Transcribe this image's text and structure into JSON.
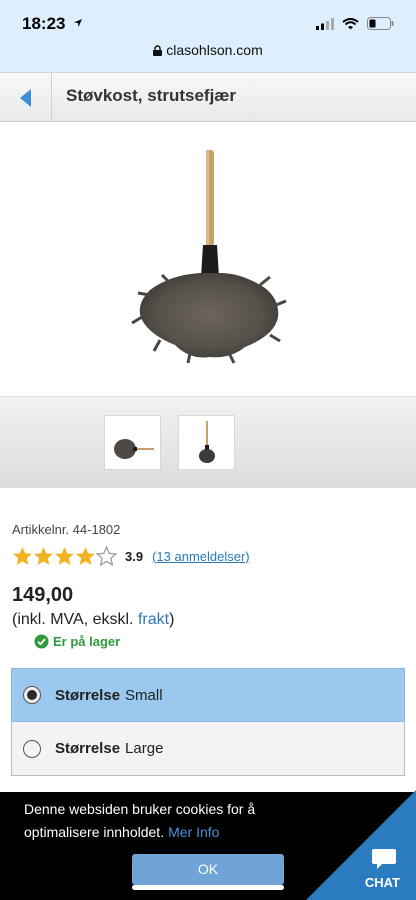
{
  "status_bar": {
    "time": "18:23",
    "url": "clasohlson.com"
  },
  "header": {
    "title": "Støvkost, strutsefjær"
  },
  "product": {
    "article_number": "Artikkelnr. 44-1802",
    "rating": 3.9,
    "rating_text": "3.9",
    "stars_filled": 4,
    "stars_total": 5,
    "reviews_link": "(13 anmeldelser)",
    "price": "149,00",
    "vat_prefix": "(inkl. MVA,  ekskl.",
    "vat_link": "frakt",
    "vat_suffix": ")",
    "stock": "Er på lager"
  },
  "options": [
    {
      "label": "Størrelse",
      "value": "Small",
      "selected": true
    },
    {
      "label": "Størrelse",
      "value": "Large",
      "selected": false
    }
  ],
  "cookie": {
    "text": "Denne websiden bruker cookies for å optimalisere innholdet.",
    "more_link": "Mer Info",
    "ok_label": "OK"
  },
  "chat": {
    "label": "CHAT"
  },
  "colors": {
    "accent": "#2b7bc0",
    "link": "#2a7ab8",
    "selected_option": "#9ac8ee",
    "in_stock": "#2f9a3a",
    "star": "#f0b323"
  }
}
